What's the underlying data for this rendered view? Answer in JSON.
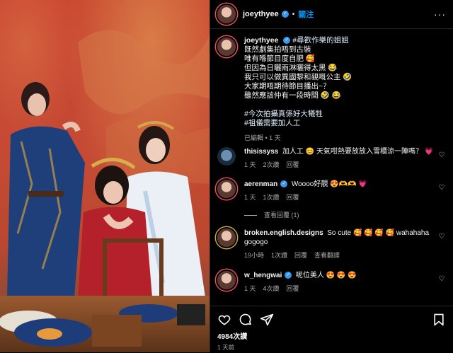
{
  "post": {
    "username": "joeythyee",
    "dot": "•",
    "follow_label": "關注",
    "more_label": "···"
  },
  "caption": {
    "username": "joeythyee",
    "tag1": "#尋歡作樂的姐姐",
    "lines": [
      "既然劇集拍唔到古裝",
      "唯有喺節目度自肥 🥰",
      "但因為日曬雨淋曬得太黑 😂",
      "我只可以做異國黎和親嘅公主 🤣",
      "大家期唔期待節目播出~？",
      "雖然應該仲有一段時間 🤣 😂"
    ],
    "tag2": "#今次拍攝真係好大犧牲",
    "tag3": "#祖儀需要加人工",
    "meta": "已編輯 • 1 天"
  },
  "comments": [
    {
      "user": "thisissyss",
      "text": "加人工 😊 天氣咁熱要放放入雪櫃涼一陣嗎？ 💗",
      "time": "1 天",
      "likes": "2次讚",
      "reply": "回覆",
      "verified": false
    },
    {
      "user": "aerenman",
      "text": "Woooo好靚 😍🫶🫶 💗",
      "time": "1 天",
      "likes": "1次讚",
      "reply": "回覆",
      "verified": true,
      "view_replies": "查看回覆 (1)"
    },
    {
      "user": "broken.english.designs",
      "text": "So cute 🥰 🥰 🥰 🥰 wahahaha gogogo",
      "time": "19小時",
      "likes": "1次讚",
      "reply": "回覆",
      "translate": "查看翻譯",
      "verified": false
    },
    {
      "user": "w_hengwai",
      "text": "呢位美人 😍 😍 😍",
      "time": "1 天",
      "likes": "4次讚",
      "reply": "回覆",
      "verified": true
    }
  ],
  "footer": {
    "likes": "4984次讚",
    "time_ago": "1 天前"
  },
  "icons": {
    "like": "heart-icon",
    "comment": "comment-icon",
    "share": "send-icon",
    "save": "bookmark-icon"
  },
  "colors": {
    "accent": "#0095f6",
    "verified": "#3797f0",
    "background": "#000000",
    "muted": "#a8a8a8"
  }
}
